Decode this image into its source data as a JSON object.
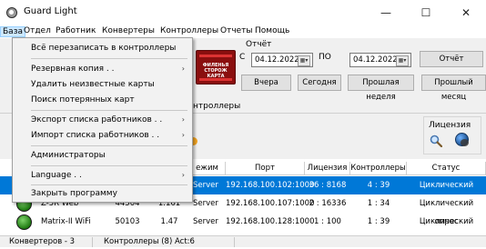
{
  "window": {
    "title": "Guard Light",
    "minimize": "—",
    "maximize": "☐",
    "close": "✕"
  },
  "menubar": [
    "База",
    "Отдел",
    "Работник",
    "Конвертеры",
    "Контроллеры",
    "Отчеты",
    "Помощь"
  ],
  "dropdown": {
    "items": [
      {
        "label": "Всё перезаписать в контроллеры",
        "submenu": false
      },
      {
        "label": "Резервная копия . .",
        "submenu": true
      },
      {
        "label": "Удалить неизвестные карты",
        "submenu": false
      },
      {
        "label": "Поиск потерянных карт",
        "submenu": false
      },
      {
        "label": "Экспорт списка работников . .",
        "submenu": true
      },
      {
        "label": "Импорт списка работников . .",
        "submenu": true
      },
      {
        "label": "Администраторы",
        "submenu": false
      },
      {
        "label": "Language . .",
        "submenu": true
      },
      {
        "label": "Закрыть программу",
        "submenu": false
      }
    ],
    "arrow": "›"
  },
  "report": {
    "group_label": "Отчёт",
    "from_label": "С",
    "from_date": "04.12.2022",
    "to_label": "ПО",
    "to_date": "04.12.2022",
    "calendar_glyph": "▦▾",
    "report_button": "Отчёт",
    "yesterday": "Вчера",
    "today": "Сегодня",
    "last_week": "Прошлая неделя",
    "last_month": "Прошлый месяц"
  },
  "card_image_text": "ФИЛЕНЬЯ\nСТОРОЖ\nКАРТА",
  "tab_fragment": "нтроллеры",
  "license": {
    "title": "Лицензия"
  },
  "table": {
    "headers": [
      "ежим",
      "Порт",
      "Лицензия",
      "Контроллеры",
      "Статус"
    ],
    "rows": [
      {
        "name": "",
        "port_num": "",
        "version": "",
        "mode": "Server",
        "address": "192.168.100.102:1000",
        "license": "36 : 8168",
        "controllers": "4 : 39",
        "status": "Циклический опрос",
        "selected": true
      },
      {
        "name": "Z-5R Web",
        "port_num": "44504",
        "version": "1.161",
        "mode": "Server",
        "address": "192.168.100.107:1000",
        "license": "2 : 16336",
        "controllers": "1 : 34",
        "status": "Циклический опрос",
        "selected": false
      },
      {
        "name": "Matrix-II WiFi",
        "port_num": "50103",
        "version": "1.47",
        "mode": "Server",
        "address": "192.168.100.128:1000",
        "license": "1 : 100",
        "controllers": "1 : 39",
        "status": "Циклический опрос",
        "selected": false
      }
    ]
  },
  "status": {
    "converters": "Конвертеров - 3",
    "controllers": "Контроллеры (8) Act:6"
  }
}
